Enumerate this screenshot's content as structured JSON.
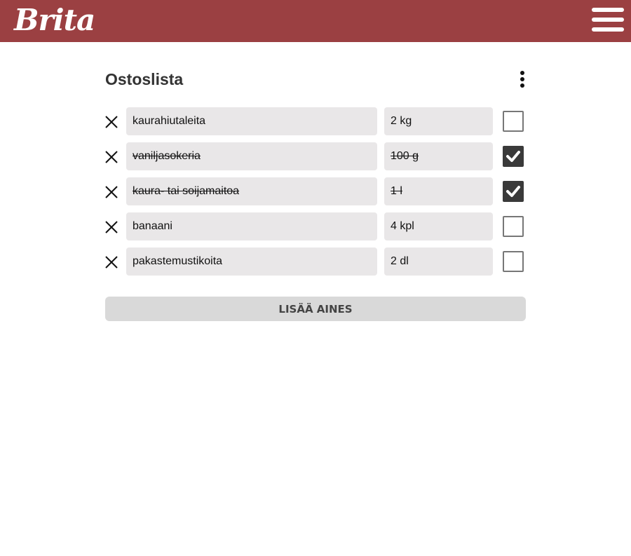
{
  "header": {
    "logo_text": "Brita",
    "menu_icon": "hamburger-menu-icon",
    "background_color": "#9b4042"
  },
  "list": {
    "title": "Ostoslista",
    "options_icon": "kebab-menu-icon",
    "items": [
      {
        "name": "kaurahiutaleita",
        "amount": "2 kg",
        "checked": false
      },
      {
        "name": "vaniljasokeria",
        "amount": "100 g",
        "checked": true
      },
      {
        "name": "kaura- tai soijamaitoa",
        "amount": "1 l",
        "checked": true
      },
      {
        "name": "banaani",
        "amount": "4 kpl",
        "checked": false
      },
      {
        "name": "pakastemustikoita",
        "amount": "2 dl",
        "checked": false
      }
    ],
    "add_button_label": "LISÄÄ AINES"
  }
}
